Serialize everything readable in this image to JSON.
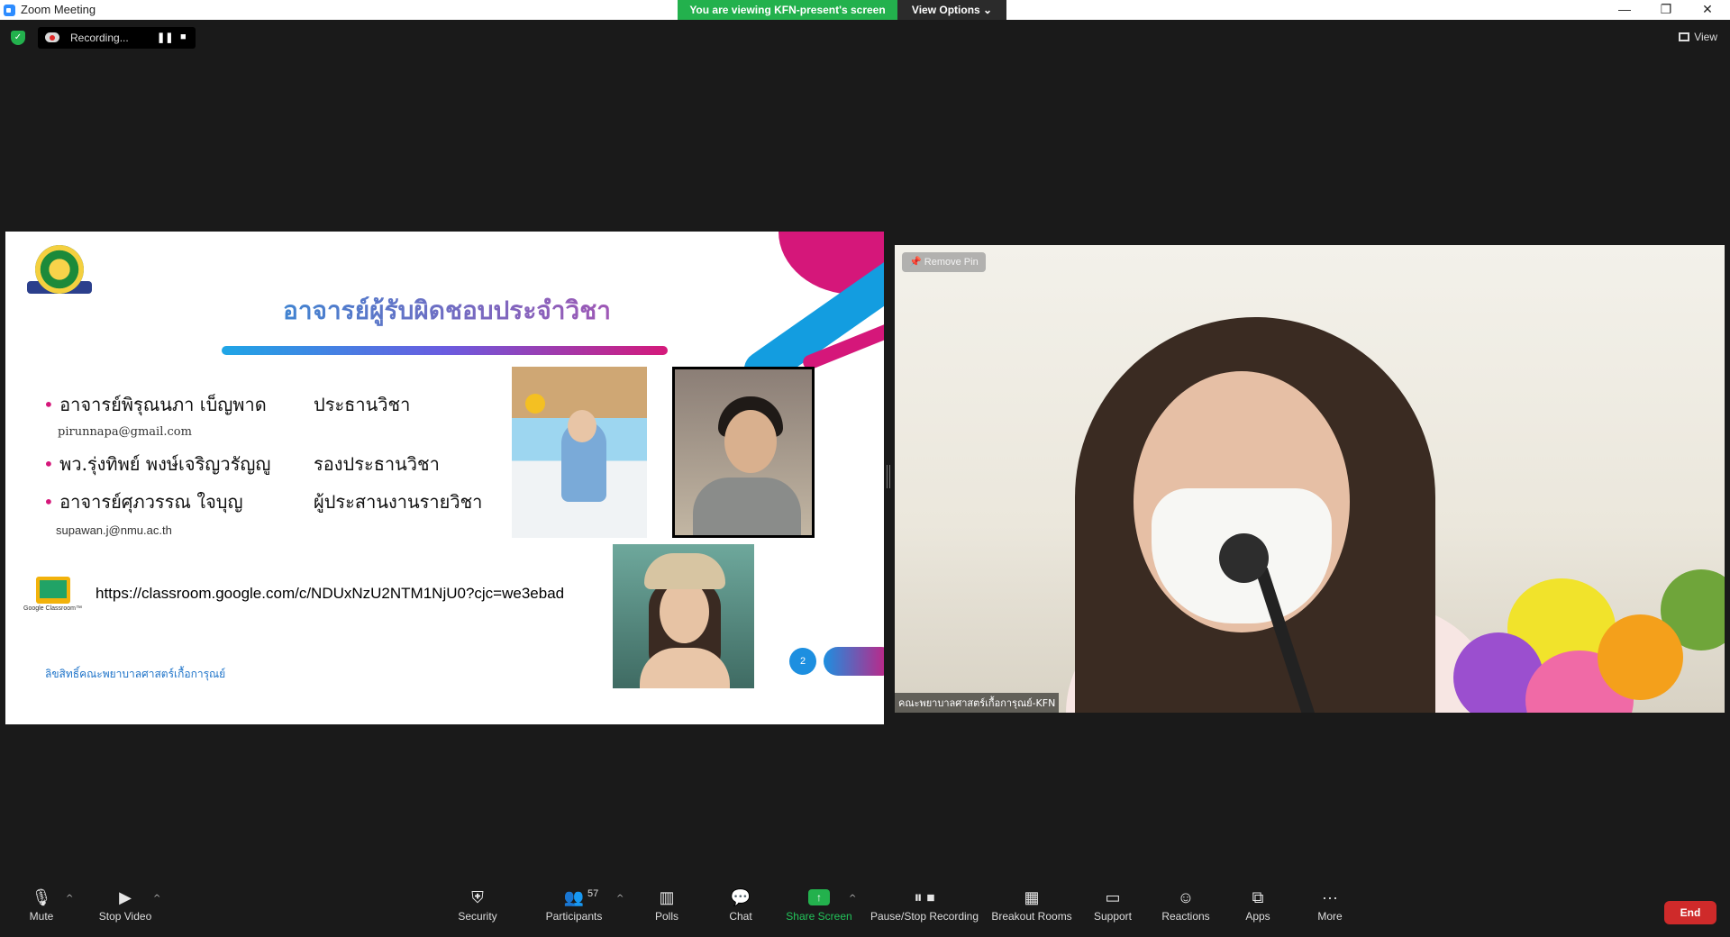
{
  "window": {
    "title": "Zoom Meeting",
    "viewing_banner": "You are viewing KFN-present's screen",
    "view_options": "View Options",
    "minimize": "—",
    "restore": "❐",
    "close": "✕"
  },
  "topbar": {
    "recording_label": "Recording...",
    "pause_glyph": "❚❚",
    "stop_glyph": "■",
    "view_label": "View"
  },
  "slide": {
    "title": "อาจารย์ผู้รับผิดชอบประจำวิชา",
    "staff": [
      {
        "name": "อาจารย์พิรุณนภา  เบ็ญพาด",
        "role": "ประธานวิชา"
      },
      {
        "name": "พว.รุ่งทิพย์ พงษ์เจริญวรัญญู",
        "role": "รองประธานวิชา"
      },
      {
        "name": "อาจารย์ศุภวรรณ ใจบุญ",
        "role": "ผู้ประสานงานรายวิชา"
      }
    ],
    "emails": [
      "pirunnapa@gmail.com",
      "supawan.j@nmu.ac.th"
    ],
    "bullet": "•",
    "classroom_label": "Google Classroom™",
    "classroom_url": "https://classroom.google.com/c/NDUxNzU2NTM1NjU0?cjc=we3ebad",
    "copyright": "ลิขสิทธิ์คณะพยาบาลศาสตร์เกื้อการุณย์",
    "page_number": "2",
    "colors": {
      "accent_pink": "#d5177a",
      "accent_blue": "#139de0"
    }
  },
  "video": {
    "remove_pin": "Remove Pin",
    "participant_name": "คณะพยาบาลศาสตร์เกื้อการุณย์-KFN"
  },
  "toolbar": {
    "mute": "Mute",
    "stop_video": "Stop Video",
    "security": "Security",
    "participants": "Participants",
    "participants_count": "57",
    "polls": "Polls",
    "chat": "Chat",
    "share_screen": "Share Screen",
    "pause_stop_recording": "Pause/Stop Recording",
    "breakout_rooms": "Breakout Rooms",
    "support": "Support",
    "reactions": "Reactions",
    "apps": "Apps",
    "more": "More",
    "end": "End",
    "caret": "^",
    "share_color": "#23b14d",
    "end_color": "#cf2a2a"
  }
}
